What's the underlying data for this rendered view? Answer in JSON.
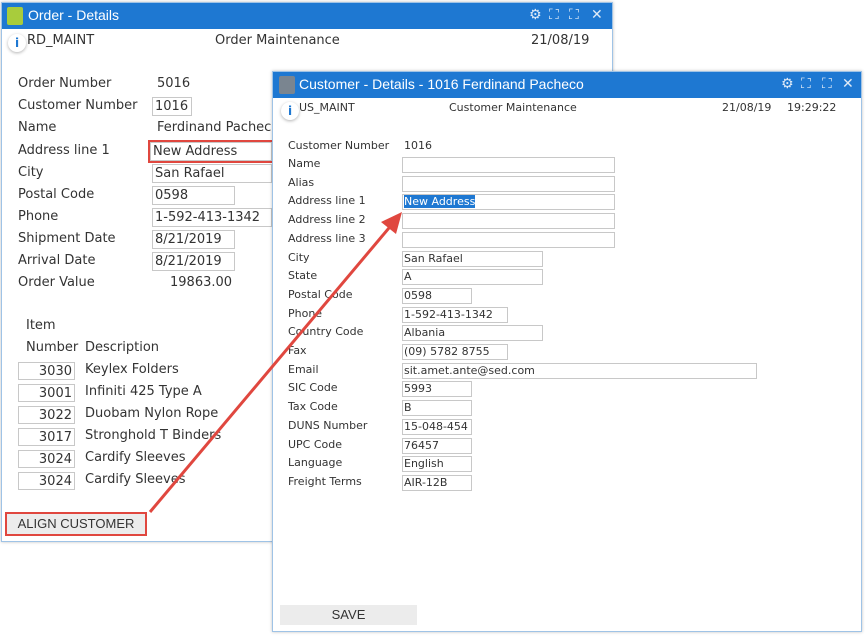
{
  "order": {
    "title": "Order - Details",
    "program": "RD_MAINT",
    "subtitle": "Order Maintenance",
    "date": "21/08/19",
    "fields": [
      {
        "label": "Order Number",
        "value": "5016"
      },
      {
        "label": "Customer Number",
        "value": "1016"
      },
      {
        "label": "Name",
        "value": "Ferdinand Pacheco"
      },
      {
        "label": "Address line 1",
        "value": "New Address"
      },
      {
        "label": "City",
        "value": "San Rafael"
      },
      {
        "label": "Postal Code",
        "value": "0598"
      },
      {
        "label": "Phone",
        "value": "1-592-413-1342"
      },
      {
        "label": "Shipment Date",
        "value": "8/21/2019"
      },
      {
        "label": "Arrival Date",
        "value": "8/21/2019"
      },
      {
        "label": "Order Value",
        "value": "19863.00"
      }
    ],
    "items_header": {
      "item": "Item",
      "number": "Number",
      "description": "Description"
    },
    "items": [
      {
        "number": "3030",
        "description": "Keylex Folders"
      },
      {
        "number": "3001",
        "description": "Infiniti 425 Type A"
      },
      {
        "number": "3022",
        "description": "Duobam Nylon Rope"
      },
      {
        "number": "3017",
        "description": "Stronghold T Binders"
      },
      {
        "number": "3024",
        "description": "Cardify Sleeves"
      },
      {
        "number": "3024",
        "description": "Cardify Sleeves"
      }
    ],
    "align_button": "ALIGN CUSTOMER"
  },
  "customer": {
    "title": "Customer - Details - 1016 Ferdinand Pacheco",
    "program": "US_MAINT",
    "subtitle": "Customer Maintenance",
    "date": "21/08/19",
    "time": "19:29:22",
    "customer_number_label": "Customer Number",
    "customer_number": "1016",
    "fields": [
      {
        "label": "Name",
        "value": ""
      },
      {
        "label": "Alias",
        "value": ""
      },
      {
        "label": "Address line 1",
        "value": "New Address"
      },
      {
        "label": "Address line 2",
        "value": ""
      },
      {
        "label": "Address line 3",
        "value": ""
      },
      {
        "label": "City",
        "value": "San Rafael"
      },
      {
        "label": "State",
        "value": "A"
      },
      {
        "label": "Postal Code",
        "value": "0598"
      },
      {
        "label": "Phone",
        "value": "1-592-413-1342"
      },
      {
        "label": "Country Code",
        "value": "Albania"
      },
      {
        "label": "Fax",
        "value": "(09) 5782 8755"
      },
      {
        "label": "Email",
        "value": "sit.amet.ante@sed.com"
      },
      {
        "label": "SIC Code",
        "value": "5993"
      },
      {
        "label": "Tax Code",
        "value": "B"
      },
      {
        "label": "DUNS Number",
        "value": "15-048-454"
      },
      {
        "label": "UPC Code",
        "value": "76457"
      },
      {
        "label": "Language",
        "value": "English"
      },
      {
        "label": "Freight Terms",
        "value": "AIR-12B"
      }
    ],
    "save_button": "SAVE"
  },
  "colors": {
    "titlebar": "#1e78d2",
    "annotation": "#e0473f"
  }
}
